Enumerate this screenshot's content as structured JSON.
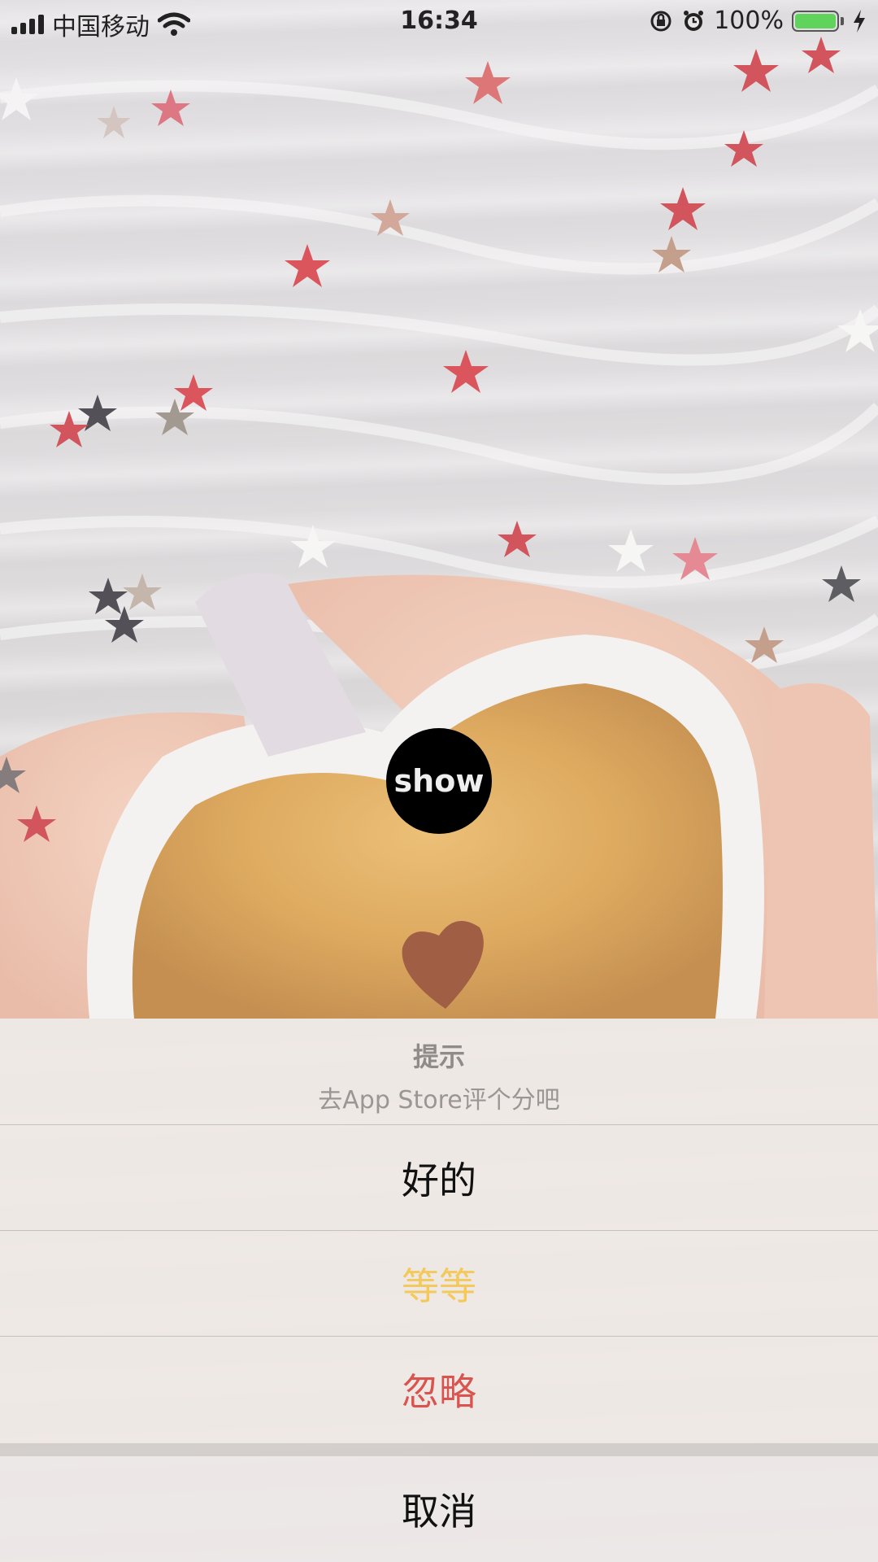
{
  "status_bar": {
    "carrier": "中国移动",
    "time": "16:34",
    "battery_percent": "100%",
    "battery_level": 1.0,
    "icons": [
      "signal-icon",
      "wifi-icon",
      "orientation-lock-icon",
      "alarm-icon",
      "battery-icon",
      "charging-icon"
    ]
  },
  "show_button": {
    "label": "show"
  },
  "action_sheet": {
    "title": "提示",
    "message": "去App Store评个分吧",
    "actions": [
      {
        "label": "好的",
        "color": "#111111"
      },
      {
        "label": "等等",
        "color": "#f3c95b"
      },
      {
        "label": "忽略",
        "color": "#d9534f"
      }
    ],
    "cancel": {
      "label": "取消",
      "color": "#111111"
    }
  }
}
